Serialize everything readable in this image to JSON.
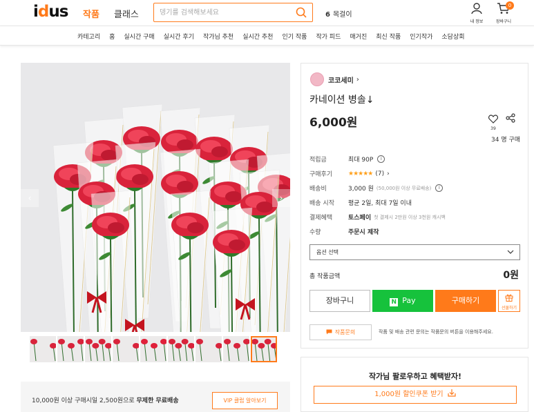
{
  "header": {
    "logo_text": "idus",
    "nav": [
      "작품",
      "클래스"
    ],
    "search_placeholder": "뎅기를 검색해보세요",
    "search_keyword_rank": "6",
    "search_keyword": "목걸이",
    "user_label": "내 정보",
    "cart_label": "장바구니",
    "cart_count": "0"
  },
  "subnav": [
    "카테고리",
    "홈",
    "실시간 구매",
    "실시간 후기",
    "작가님 추천",
    "실시간 추천",
    "인기 작품",
    "작가 피드",
    "매거진",
    "최신 작품",
    "인기작가",
    "소담상회"
  ],
  "gallery": {
    "prev": "‹",
    "next": "›",
    "thumb_count": 9,
    "active_thumb": 8
  },
  "shipping_banner": {
    "text_prefix": "10,000원 이상 구매시일 2,500원으로 ",
    "text_bold": "무제한 무료배송",
    "vip_button": "VIP 클럽 알아보기"
  },
  "product": {
    "seller_name": "코코세미",
    "title": "카네이션 병솔↓",
    "price": "6,000원",
    "likes": "39",
    "buy_count": "34 명 구매",
    "info": {
      "points_label": "적립금",
      "points_value": "최대 90P",
      "review_label": "구매후기",
      "review_stars": "★★★★★",
      "review_count": "(7)",
      "shipping_label": "배송비",
      "shipping_value": "3,000 원",
      "shipping_sub": "(50,000원 이상 무료배송)",
      "start_label": "배송 시작",
      "start_value": "평균 2일, 최대 7일 이내",
      "payment_label": "결제혜택",
      "payment_value": "토스페이",
      "payment_sub": "첫 결제시 2만원 이상 3천원 캐시백",
      "quantity_label": "수량",
      "quantity_value": "주문시 제작"
    },
    "option_label": "옵션 선택",
    "total_label": "총 작품금액",
    "total_value": "0원",
    "btn_cart": "장바구니",
    "btn_npay": "Pay",
    "btn_npay_n": "N",
    "btn_buy": "구매하기",
    "btn_gift": "선물하기",
    "inquiry_button": "작품문의",
    "inquiry_text": "작품 및 배송 관련 문의는 작품문의 버튼을 이용해주세요."
  },
  "follow": {
    "title": "작가님 팔로우하고 혜택받자!",
    "coupon_button": "1,000원 할인쿠폰 받기"
  },
  "colors": {
    "accent": "#ff7a1a",
    "npay": "#16c23c",
    "stars": "#ff9f1a"
  }
}
